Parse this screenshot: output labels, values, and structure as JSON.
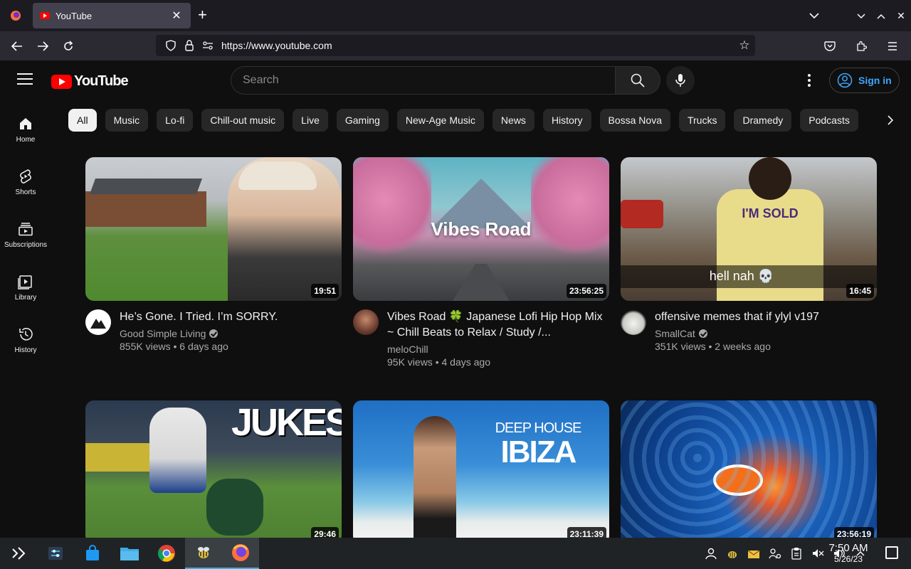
{
  "browser": {
    "tab_title": "YouTube",
    "url": "https://www.youtube.com"
  },
  "header": {
    "search_placeholder": "Search",
    "sign_in": "Sign in"
  },
  "sidebar": {
    "items": [
      {
        "label": "Home",
        "icon": "home-icon"
      },
      {
        "label": "Shorts",
        "icon": "shorts-icon"
      },
      {
        "label": "Subscriptions",
        "icon": "subscriptions-icon"
      },
      {
        "label": "Library",
        "icon": "library-icon"
      },
      {
        "label": "History",
        "icon": "history-icon"
      }
    ]
  },
  "chips": [
    "All",
    "Music",
    "Lo-fi",
    "Chill-out music",
    "Live",
    "Gaming",
    "New-Age Music",
    "News",
    "History",
    "Bossa Nova",
    "Trucks",
    "Dramedy",
    "Podcasts"
  ],
  "videos": [
    {
      "title": "He’s Gone. I Tried. I’m SORRY.",
      "channel": "Good Simple Living",
      "verified": true,
      "stats": "855K views • 6 days ago",
      "duration": "19:51"
    },
    {
      "title": "Vibes Road 🍀 Japanese Lofi Hip Hop Mix ~ Chill Beats to Relax / Study /...",
      "channel": "meloChill",
      "verified": false,
      "stats": "95K views • 4 days ago",
      "duration": "23:56:25",
      "thumb_text": "Vibes Road"
    },
    {
      "title": "offensive memes that if ylyl v197",
      "channel": "SmallCat",
      "verified": true,
      "stats": "351K views • 2 weeks ago",
      "duration": "16:45",
      "thumb_text": "I'M SOLD",
      "thumb_caption": "hell nah 💀"
    },
    {
      "title": "",
      "channel": "",
      "stats": "",
      "duration": "29:46",
      "thumb_text": "JUKES"
    },
    {
      "title": "",
      "channel": "",
      "stats": "",
      "duration": "23:11:39",
      "thumb_text_top": "DEEP HOUSE",
      "thumb_text": "IBIZA"
    },
    {
      "title": "",
      "channel": "",
      "stats": "",
      "duration": "23:56:19"
    }
  ],
  "taskbar": {
    "time": "7:50 AM",
    "date": "5/26/23"
  },
  "colors": {
    "youtube_red": "#ff0000",
    "link_blue": "#3ea6ff",
    "background": "#0f0f0f"
  }
}
